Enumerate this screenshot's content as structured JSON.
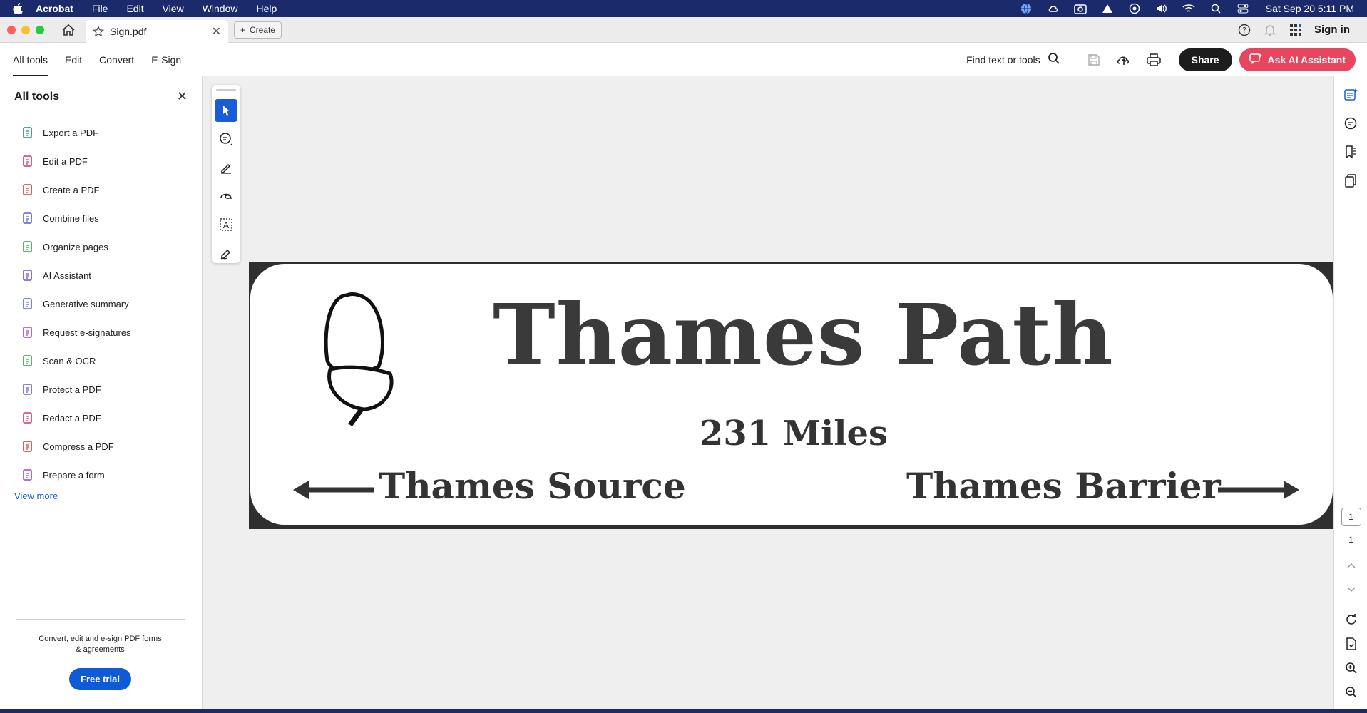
{
  "menubar": {
    "app_name": "Acrobat",
    "items": [
      "File",
      "Edit",
      "View",
      "Window",
      "Help"
    ],
    "clock": "Sat Sep 20  5:11 PM"
  },
  "tabbar": {
    "doc_tab_title": "Sign.pdf",
    "create_label": "Create",
    "sign_in": "Sign in"
  },
  "toolbar": {
    "tabs": [
      "All tools",
      "Edit",
      "Convert",
      "E-Sign"
    ],
    "find_label": "Find text or tools",
    "share_label": "Share",
    "ai_label": "Ask AI Assistant"
  },
  "left_panel": {
    "title": "All tools",
    "items": [
      {
        "label": "Export a PDF",
        "icon": "export-pdf-icon",
        "color": "#1a8a7a"
      },
      {
        "label": "Edit a PDF",
        "icon": "edit-pdf-icon",
        "color": "#d6336c"
      },
      {
        "label": "Create a PDF",
        "icon": "create-pdf-icon",
        "color": "#e03131"
      },
      {
        "label": "Combine files",
        "icon": "combine-files-icon",
        "color": "#5c5ce0"
      },
      {
        "label": "Organize pages",
        "icon": "organize-pages-icon",
        "color": "#2f9e44"
      },
      {
        "label": "AI Assistant",
        "icon": "ai-assistant-icon",
        "color": "#7048e8"
      },
      {
        "label": "Generative summary",
        "icon": "generative-summary-icon",
        "color": "#5c5ce0"
      },
      {
        "label": "Request e-signatures",
        "icon": "request-esignatures-icon",
        "color": "#ae3ec9"
      },
      {
        "label": "Scan & OCR",
        "icon": "scan-ocr-icon",
        "color": "#2f9e44"
      },
      {
        "label": "Protect a PDF",
        "icon": "protect-pdf-icon",
        "color": "#5c5ce0"
      },
      {
        "label": "Redact a PDF",
        "icon": "redact-pdf-icon",
        "color": "#d6336c"
      },
      {
        "label": "Compress a PDF",
        "icon": "compress-pdf-icon",
        "color": "#e03131"
      },
      {
        "label": "Prepare a form",
        "icon": "prepare-form-icon",
        "color": "#ae3ec9"
      }
    ],
    "view_more": "View more",
    "promo_line1": "Convert, edit and e-sign PDF forms",
    "promo_line2": "& agreements",
    "free_trial": "Free trial"
  },
  "document": {
    "title": "Thames Path",
    "miles": "231 Miles",
    "left_dest": "Thames Source",
    "right_dest": "Thames Barrier"
  },
  "right_rail": {
    "current_page": "1",
    "total_pages": "1"
  },
  "colors": {
    "menubar_bg": "#1b2a6b",
    "accent_blue": "#1a5bd6",
    "ai_button": "#e8465e"
  }
}
